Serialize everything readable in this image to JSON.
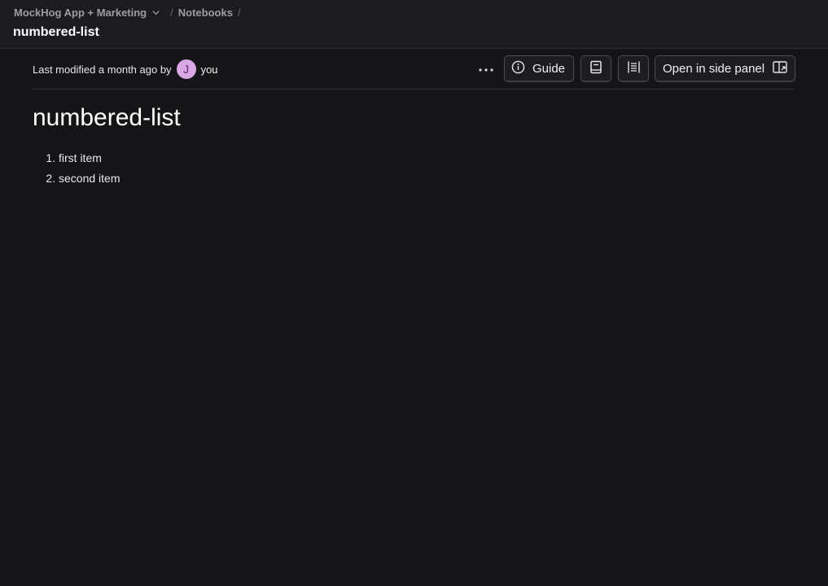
{
  "breadcrumb": {
    "project": "MockHog App + Marketing",
    "section": "Notebooks",
    "separator": "/"
  },
  "header": {
    "title": "numbered-list"
  },
  "meta": {
    "modified_text": "Last modified a month ago by",
    "avatar_initial": "J",
    "user": "you"
  },
  "toolbar": {
    "guide_label": "Guide",
    "side_panel_label": "Open in side panel"
  },
  "notebook": {
    "title": "numbered-list",
    "items": [
      "first item",
      "second item"
    ]
  },
  "colors": {
    "background": "#151518",
    "topbar": "#1b1b20",
    "avatar": "#dba8e6"
  },
  "icons": {
    "project_dropdown": "chevron-down-icon",
    "more": "more-icon",
    "guide": "info-icon",
    "book": "book-icon",
    "toc": "table-of-contents-icon",
    "side_panel": "open-side-panel-icon"
  }
}
